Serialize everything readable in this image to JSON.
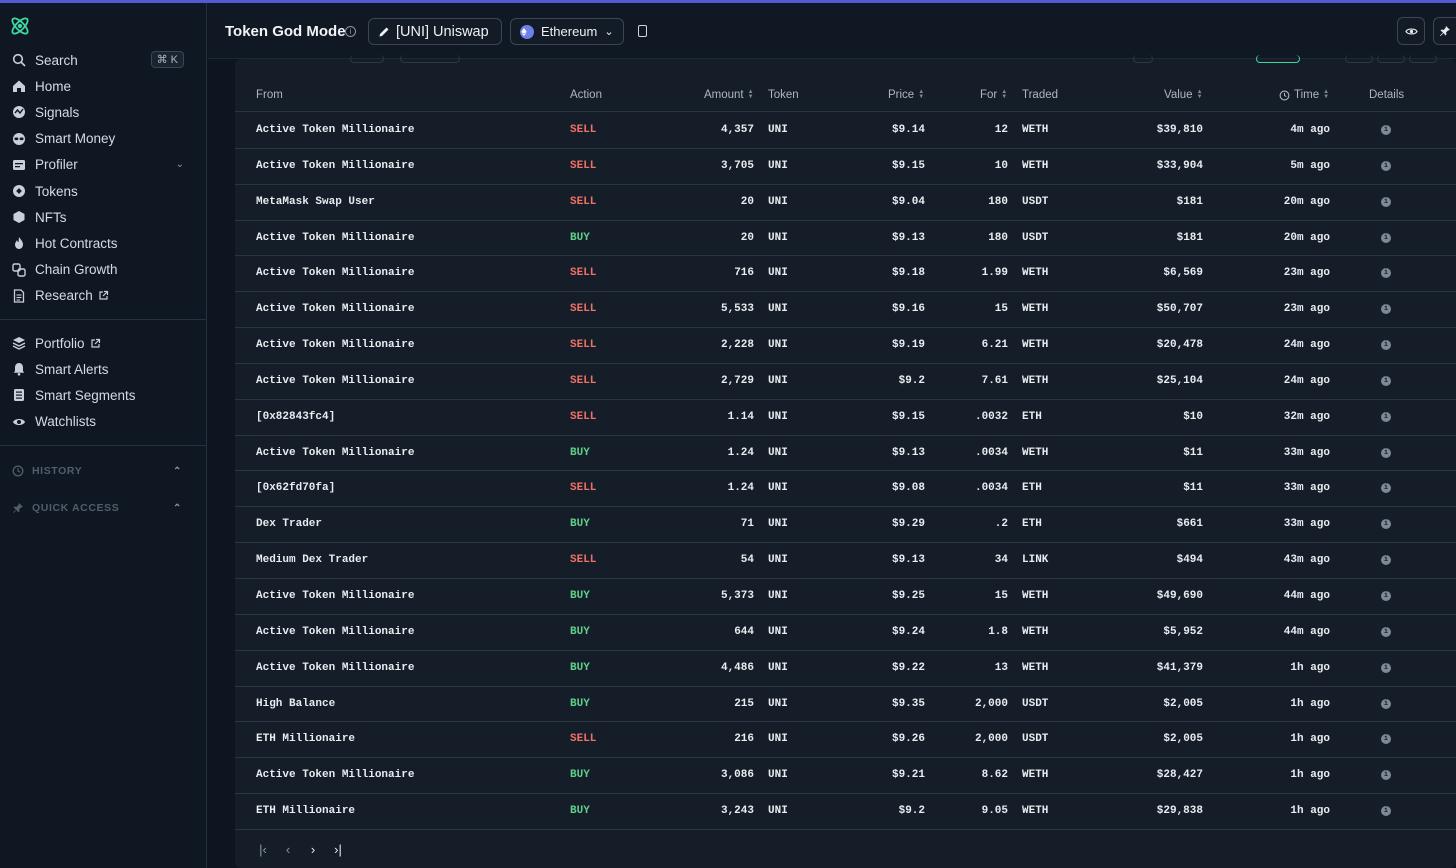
{
  "sidebar": {
    "search": {
      "label": "Search",
      "shortcut": "⌘ K"
    },
    "items": [
      {
        "label": "Home",
        "icon": "home-icon"
      },
      {
        "label": "Signals",
        "icon": "signals-icon"
      },
      {
        "label": "Smart Money",
        "icon": "smart-money-icon"
      },
      {
        "label": "Profiler",
        "icon": "profiler-icon"
      },
      {
        "label": "Tokens",
        "icon": "tokens-icon"
      },
      {
        "label": "NFTs",
        "icon": "nft-icon"
      },
      {
        "label": "Hot Contracts",
        "icon": "flame-icon"
      },
      {
        "label": "Chain Growth",
        "icon": "chain-icon"
      },
      {
        "label": "Research",
        "icon": "document-icon"
      }
    ],
    "items2": [
      {
        "label": "Portfolio",
        "icon": "portfolio-icon"
      },
      {
        "label": "Smart Alerts",
        "icon": "bell-icon"
      },
      {
        "label": "Smart Segments",
        "icon": "segments-icon"
      },
      {
        "label": "Watchlists",
        "icon": "eye-icon"
      }
    ],
    "history": "HISTORY",
    "quick_access": "QUICK ACCESS"
  },
  "header": {
    "title": "Token God Mode",
    "token": "[UNI] Uniswap",
    "chain": "Ethereum"
  },
  "table": {
    "columns": {
      "from": "From",
      "action": "Action",
      "amount": "Amount",
      "token": "Token",
      "price": "Price",
      "for": "For",
      "traded": "Traded",
      "value": "Value",
      "time": "Time",
      "details": "Details"
    },
    "rows": [
      {
        "from": "Active Token Millionaire",
        "action": "SELL",
        "amount": "4,357",
        "token": "UNI",
        "price": "$9.14",
        "for": "12",
        "traded": "WETH",
        "value": "$39,810",
        "time": "4m ago"
      },
      {
        "from": "Active Token Millionaire",
        "action": "SELL",
        "amount": "3,705",
        "token": "UNI",
        "price": "$9.15",
        "for": "10",
        "traded": "WETH",
        "value": "$33,904",
        "time": "5m ago"
      },
      {
        "from": "MetaMask Swap User",
        "action": "SELL",
        "amount": "20",
        "token": "UNI",
        "price": "$9.04",
        "for": "180",
        "traded": "USDT",
        "value": "$181",
        "time": "20m ago"
      },
      {
        "from": "Active Token Millionaire",
        "action": "BUY",
        "amount": "20",
        "token": "UNI",
        "price": "$9.13",
        "for": "180",
        "traded": "USDT",
        "value": "$181",
        "time": "20m ago"
      },
      {
        "from": "Active Token Millionaire",
        "action": "SELL",
        "amount": "716",
        "token": "UNI",
        "price": "$9.18",
        "for": "1.99",
        "traded": "WETH",
        "value": "$6,569",
        "time": "23m ago"
      },
      {
        "from": "Active Token Millionaire",
        "action": "SELL",
        "amount": "5,533",
        "token": "UNI",
        "price": "$9.16",
        "for": "15",
        "traded": "WETH",
        "value": "$50,707",
        "time": "23m ago"
      },
      {
        "from": "Active Token Millionaire",
        "action": "SELL",
        "amount": "2,228",
        "token": "UNI",
        "price": "$9.19",
        "for": "6.21",
        "traded": "WETH",
        "value": "$20,478",
        "time": "24m ago"
      },
      {
        "from": "Active Token Millionaire",
        "action": "SELL",
        "amount": "2,729",
        "token": "UNI",
        "price": "$9.2",
        "for": "7.61",
        "traded": "WETH",
        "value": "$25,104",
        "time": "24m ago"
      },
      {
        "from": "[0x82843fc4]",
        "action": "SELL",
        "amount": "1.14",
        "token": "UNI",
        "price": "$9.15",
        "for": ".0032",
        "traded": "ETH",
        "value": "$10",
        "time": "32m ago"
      },
      {
        "from": "Active Token Millionaire",
        "action": "BUY",
        "amount": "1.24",
        "token": "UNI",
        "price": "$9.13",
        "for": ".0034",
        "traded": "WETH",
        "value": "$11",
        "time": "33m ago"
      },
      {
        "from": "[0x62fd70fa]",
        "action": "SELL",
        "amount": "1.24",
        "token": "UNI",
        "price": "$9.08",
        "for": ".0034",
        "traded": "ETH",
        "value": "$11",
        "time": "33m ago"
      },
      {
        "from": "Dex Trader",
        "action": "BUY",
        "amount": "71",
        "token": "UNI",
        "price": "$9.29",
        "for": ".2",
        "traded": "ETH",
        "value": "$661",
        "time": "33m ago"
      },
      {
        "from": "Medium Dex Trader",
        "action": "SELL",
        "amount": "54",
        "token": "UNI",
        "price": "$9.13",
        "for": "34",
        "traded": "LINK",
        "value": "$494",
        "time": "43m ago"
      },
      {
        "from": "Active Token Millionaire",
        "action": "BUY",
        "amount": "5,373",
        "token": "UNI",
        "price": "$9.25",
        "for": "15",
        "traded": "WETH",
        "value": "$49,690",
        "time": "44m ago"
      },
      {
        "from": "Active Token Millionaire",
        "action": "BUY",
        "amount": "644",
        "token": "UNI",
        "price": "$9.24",
        "for": "1.8",
        "traded": "WETH",
        "value": "$5,952",
        "time": "44m ago"
      },
      {
        "from": "Active Token Millionaire",
        "action": "BUY",
        "amount": "4,486",
        "token": "UNI",
        "price": "$9.22",
        "for": "13",
        "traded": "WETH",
        "value": "$41,379",
        "time": "1h ago"
      },
      {
        "from": "High Balance",
        "action": "BUY",
        "amount": "215",
        "token": "UNI",
        "price": "$9.35",
        "for": "2,000",
        "traded": "USDT",
        "value": "$2,005",
        "time": "1h ago"
      },
      {
        "from": "ETH Millionaire",
        "action": "SELL",
        "amount": "216",
        "token": "UNI",
        "price": "$9.26",
        "for": "2,000",
        "traded": "USDT",
        "value": "$2,005",
        "time": "1h ago"
      },
      {
        "from": "Active Token Millionaire",
        "action": "BUY",
        "amount": "3,086",
        "token": "UNI",
        "price": "$9.21",
        "for": "8.62",
        "traded": "WETH",
        "value": "$28,427",
        "time": "1h ago"
      },
      {
        "from": "ETH Millionaire",
        "action": "BUY",
        "amount": "3,243",
        "token": "UNI",
        "price": "$9.2",
        "for": "9.05",
        "traded": "WETH",
        "value": "$29,838",
        "time": "1h ago"
      }
    ]
  },
  "colors": {
    "sell": "#f07167",
    "buy": "#5fd18a",
    "accent": "#4f5bd5"
  }
}
